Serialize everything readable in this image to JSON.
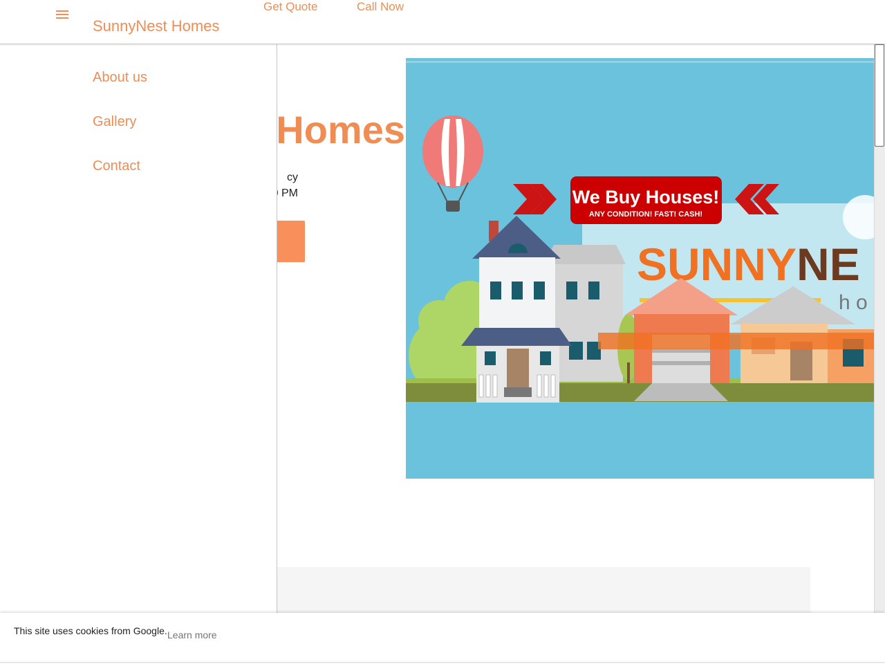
{
  "header": {
    "site_title": "SunnyNest Homes",
    "links": [
      "Get Quote",
      "Call Now"
    ],
    "menu_icon": "hamburger-menu-icon"
  },
  "drawer": {
    "items": [
      "About us",
      "Gallery",
      "Contact"
    ]
  },
  "hero": {
    "title_visible": "Homes",
    "line1_visible": "cy",
    "line2_visible": "0 PM",
    "image": {
      "banner_text": "We Buy Houses!",
      "banner_subtext": "ANY CONDITION! FAST! CASH!",
      "logo_part1": "SUNNY",
      "logo_part2": "NE",
      "logo_subtext": "h o"
    }
  },
  "cookie_bar": {
    "text": "This site uses cookies from Google.",
    "link": "Learn more"
  },
  "colors": {
    "accent": "#f08d55",
    "button": "#f98f5b",
    "image_sky": "#6ac2dc",
    "banner_red": "#cc0000",
    "logo_orange": "#f07122",
    "logo_brown": "#6b3a1f"
  }
}
